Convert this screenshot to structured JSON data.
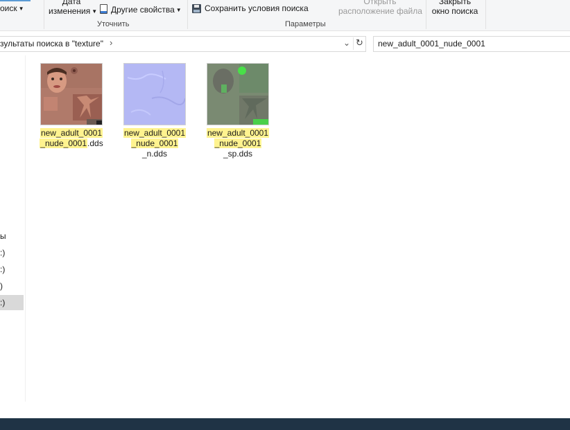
{
  "ribbon": {
    "search_btn": "оиск",
    "date_modified_line1": "Дата",
    "date_modified_line2": "изменения",
    "other_props": "Другие свойства",
    "save_search": "Сохранить условия поиска",
    "open_location_line1": "Открыть",
    "open_location_line2": "расположение файла",
    "close_line1": "Закрыть",
    "close_line2": "окно поиска",
    "group_refine": "Уточнить",
    "group_options": "Параметры"
  },
  "address": {
    "text": "зультаты поиска в \"texture\"",
    "chevron": "›"
  },
  "search": {
    "value": "new_adult_0001_nude_0001"
  },
  "nav": {
    "items": [
      "ы",
      ":)",
      ":)",
      ")",
      ":)"
    ]
  },
  "files": [
    {
      "lines": [
        [
          "new_adult_0001",
          ""
        ],
        [
          "_nude_0001",
          ".dds"
        ]
      ]
    },
    {
      "lines": [
        [
          "new_adult_0001",
          ""
        ],
        [
          "_nude_0001",
          ""
        ],
        [
          "",
          "_n.dds"
        ]
      ]
    },
    {
      "lines": [
        [
          "new_adult_0001",
          ""
        ],
        [
          "_nude_0001",
          ""
        ],
        [
          "",
          "_sp.dds"
        ]
      ]
    }
  ],
  "colors": {
    "highlight": "#fff38f",
    "taskbar": "#1f3345",
    "normal_map": "#b4b8f4",
    "spec_map": "#7a8a72"
  }
}
